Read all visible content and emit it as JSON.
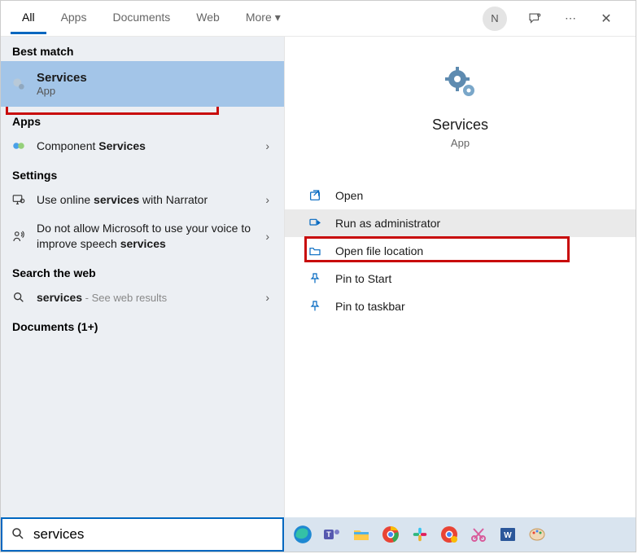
{
  "tabs": {
    "all": "All",
    "apps": "Apps",
    "documents": "Documents",
    "web": "Web",
    "more": "More"
  },
  "avatar_letter": "N",
  "left": {
    "best_match_label": "Best match",
    "best_match": {
      "title": "Services",
      "sub": "App"
    },
    "apps_label": "Apps",
    "apps_item_prefix": "Component ",
    "apps_item_bold": "Services",
    "settings_label": "Settings",
    "setting1_pre": "Use online ",
    "setting1_bold": "services",
    "setting1_post": " with Narrator",
    "setting2_pre": "Do not allow Microsoft to use your voice to improve speech ",
    "setting2_bold": "services",
    "web_label": "Search the web",
    "web_item_bold": "services",
    "web_item_post": " - See web results",
    "docs_label": "Documents (1+)"
  },
  "right": {
    "title": "Services",
    "sub": "App",
    "actions": {
      "open": "Open",
      "run_admin": "Run as administrator",
      "open_loc": "Open file location",
      "pin_start": "Pin to Start",
      "pin_taskbar": "Pin to taskbar"
    }
  },
  "search": {
    "value": "services"
  }
}
